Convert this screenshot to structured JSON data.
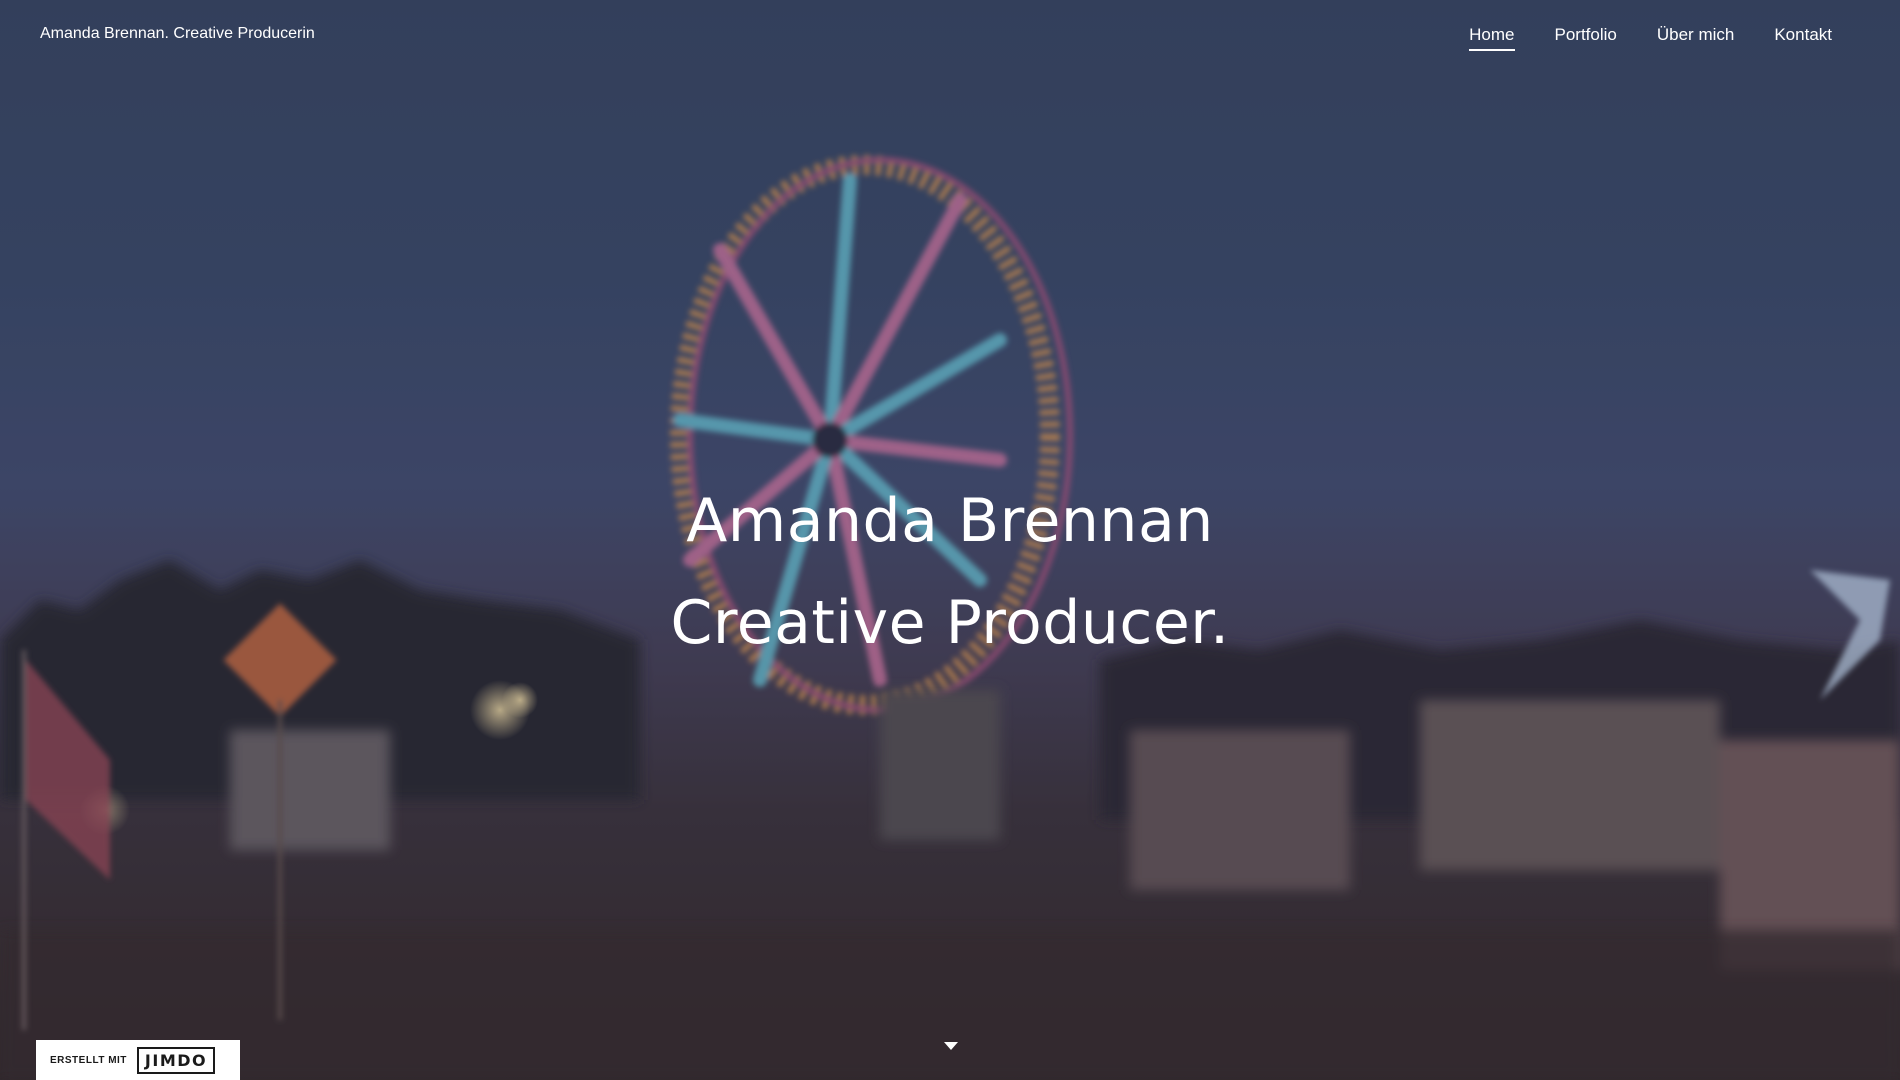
{
  "header": {
    "site_title": "Amanda Brennan. Creative Producerin",
    "nav": [
      {
        "label": "Home",
        "active": true
      },
      {
        "label": "Portfolio",
        "active": false
      },
      {
        "label": "Über mich",
        "active": false
      },
      {
        "label": "Kontakt",
        "active": false
      }
    ]
  },
  "hero": {
    "line1": "Amanda Brennan",
    "line2": "Creative Producer."
  },
  "background": {
    "scene": "night fairground with illuminated ferris wheel",
    "colors": {
      "sky_top": "#3a4a6b",
      "ground": "#352a2c",
      "wheel_pink": "#e07fb0",
      "wheel_cyan": "#6fd3e8",
      "wheel_orange": "#e8a05a"
    }
  },
  "badge": {
    "prefix": "ERSTELLT MIT",
    "brand": "JIMDO"
  },
  "icons": {
    "scroll": "chevron-down-icon"
  }
}
